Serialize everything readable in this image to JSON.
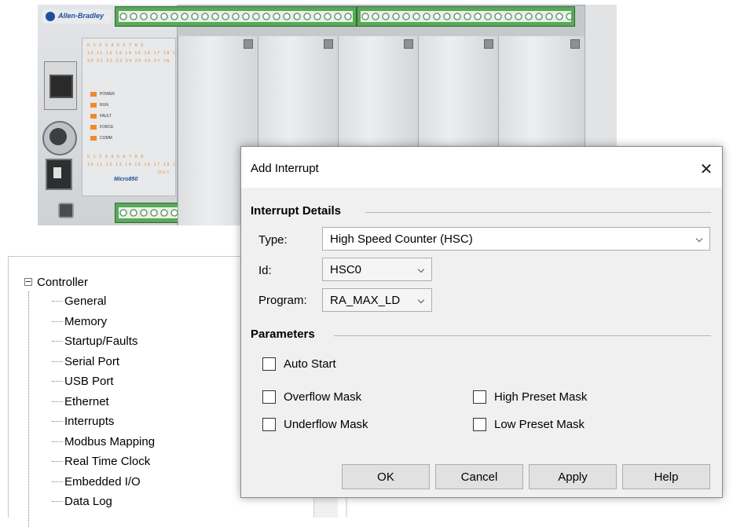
{
  "hardware": {
    "brand": "Allen-Bradley",
    "model": "Micro850",
    "led_rows": [
      "0 1 2 3 4 5 6 7 8 9",
      "10 11 12 13 14 15 16 17 18 19",
      "20 21 22 23 24 25 26 27    IN",
      "0 1 2 3 4 5 6 7 8 9",
      "10 11 12 13 14 15 16 17 18 19",
      "OUT"
    ],
    "status_leds": [
      "POWER",
      "RUN",
      "FAULT",
      "FORCE",
      "COMM"
    ],
    "accent_color": "#f08a2c",
    "terminal_color": "#5aa85a"
  },
  "tree": {
    "root": "Controller",
    "items": [
      "General",
      "Memory",
      "Startup/Faults",
      "Serial Port",
      "USB Port",
      "Ethernet",
      "Interrupts",
      "Modbus Mapping",
      "Real Time Clock",
      "Embedded I/O",
      "Data Log"
    ]
  },
  "dialog": {
    "title": "Add Interrupt",
    "close_icon": "close-icon",
    "interrupt_details": {
      "heading": "Interrupt Details",
      "type_label": "Type:",
      "type_value": "High Speed Counter (HSC)",
      "id_label": "Id:",
      "id_value": "HSC0",
      "program_label": "Program:",
      "program_value": "RA_MAX_LD"
    },
    "parameters": {
      "heading": "Parameters",
      "auto_start": "Auto Start",
      "overflow_mask": "Overflow Mask",
      "underflow_mask": "Underflow Mask",
      "high_preset_mask": "High Preset Mask",
      "low_preset_mask": "Low Preset Mask"
    },
    "buttons": {
      "ok": "OK",
      "cancel": "Cancel",
      "apply": "Apply",
      "help": "Help"
    }
  }
}
